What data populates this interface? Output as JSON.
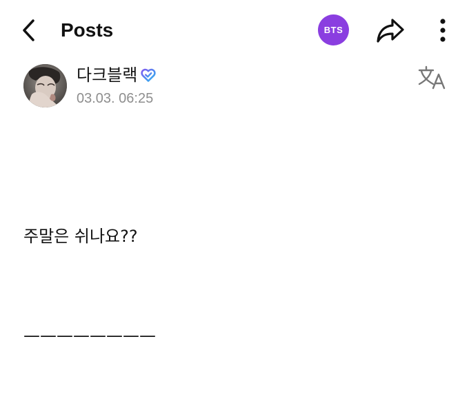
{
  "header": {
    "title": "Posts",
    "back_icon": "chevron-left-icon",
    "community_badge": {
      "label": "BTS",
      "color": "#8a3ee0"
    },
    "share_icon": "share-icon",
    "more_icon": "more-vertical-icon"
  },
  "post": {
    "author": {
      "name": "다크블랙",
      "verified_icon": "heart-badge-icon",
      "avatar_icon": "profile-photo"
    },
    "timestamp": "03.03. 06:25",
    "translate_icon": "translate-icon",
    "body": "주말은 쉬나요??",
    "dashes": "————————"
  },
  "colors": {
    "text": "#111111",
    "muted": "#8e8e8e",
    "accent": "#8a3ee0",
    "badge_gradient_start": "#7f5af0",
    "badge_gradient_end": "#2bb6f0"
  }
}
